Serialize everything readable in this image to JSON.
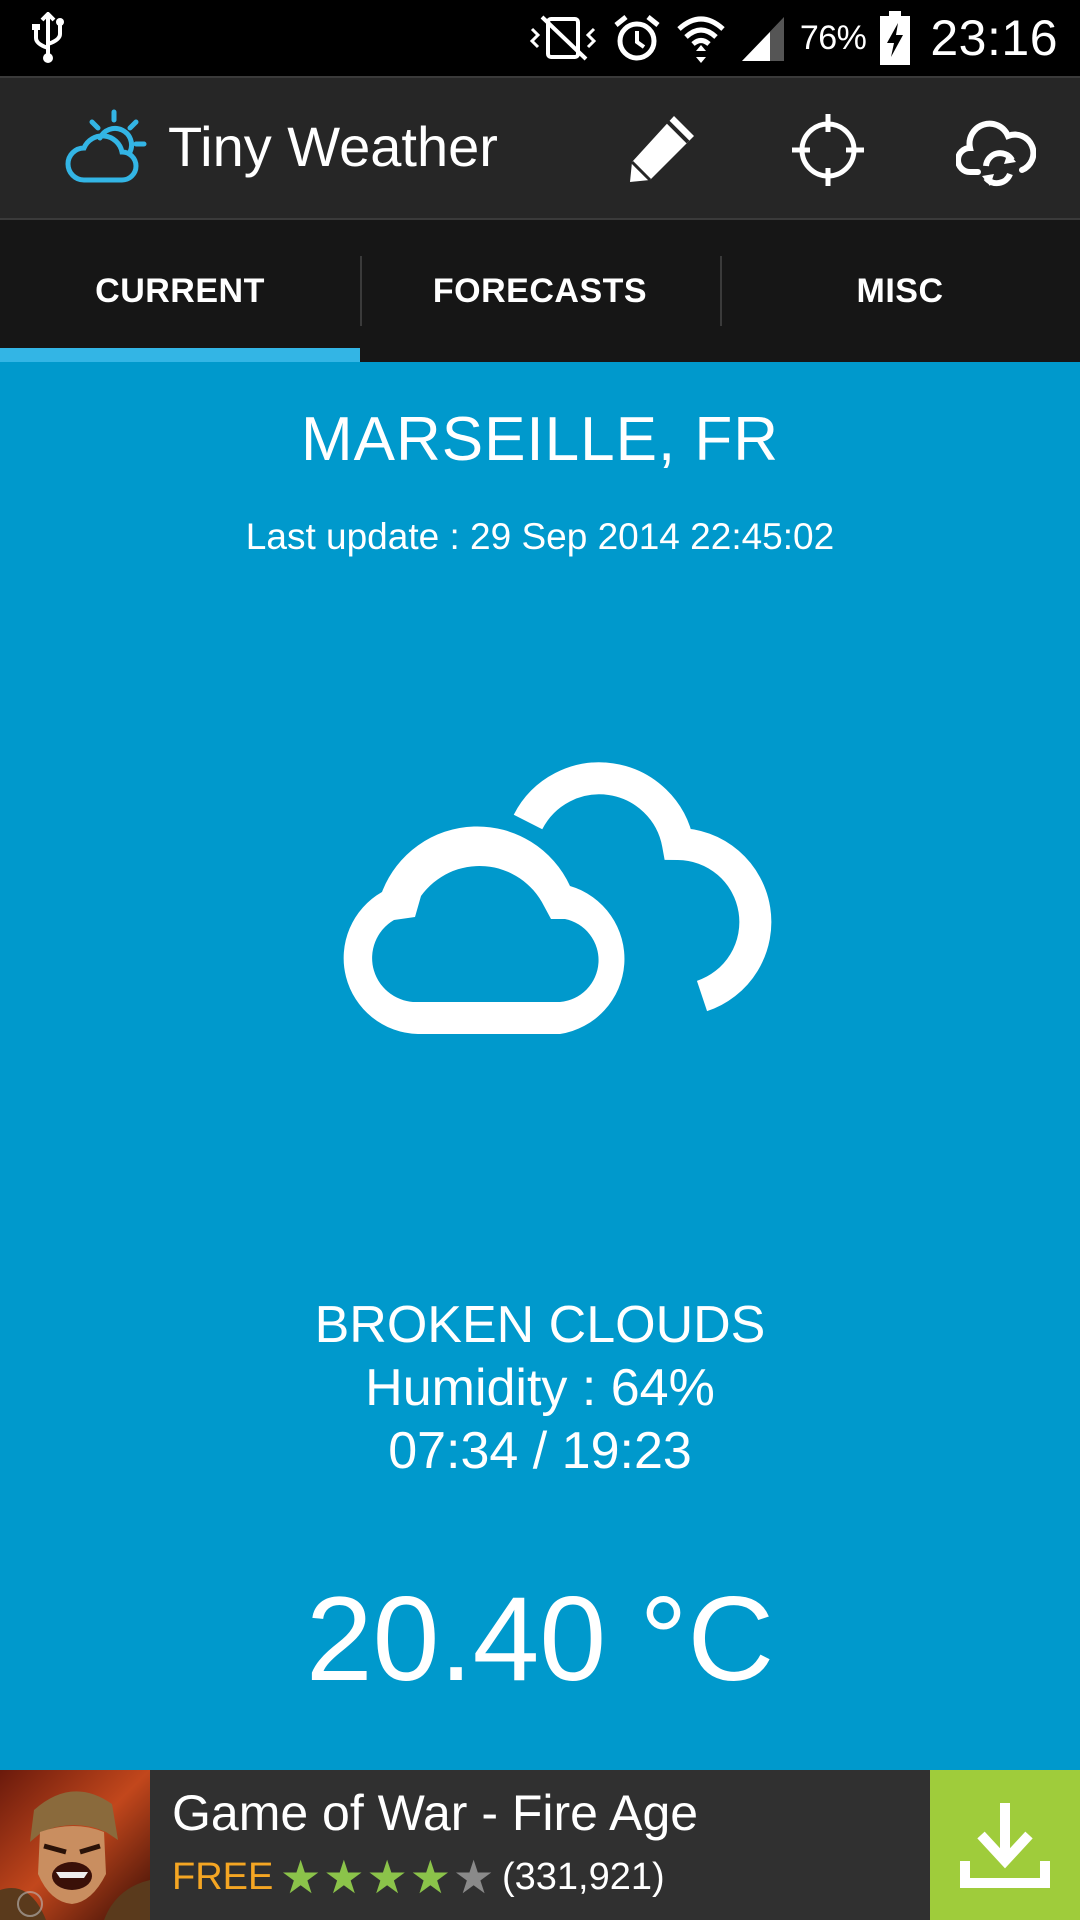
{
  "status_bar": {
    "battery_percent": "76%",
    "time": "23:16",
    "icons": [
      "usb-icon",
      "vibrate-mute-icon",
      "alarm-icon",
      "wifi-icon",
      "signal-icon",
      "battery-charging-icon"
    ]
  },
  "app_bar": {
    "title": "Tiny Weather",
    "logo_icon": "partly-cloudy-sun-icon",
    "actions": [
      {
        "name": "edit",
        "icon": "pencil-icon"
      },
      {
        "name": "locate",
        "icon": "crosshair-icon"
      },
      {
        "name": "refresh",
        "icon": "cloud-refresh-icon"
      }
    ]
  },
  "tabs": [
    {
      "label": "CURRENT",
      "selected": true
    },
    {
      "label": "FORECASTS",
      "selected": false
    },
    {
      "label": "MISC",
      "selected": false
    }
  ],
  "current": {
    "city": "MARSEILLE, FR",
    "last_update": "Last update : 29 Sep 2014 22:45:02",
    "condition_icon": "broken-clouds-icon",
    "condition": "BROKEN CLOUDS",
    "humidity": "Humidity : 64%",
    "sun_times": "07:34 / 19:23",
    "temperature": "20.40 °C"
  },
  "ad": {
    "title": "Game of War - Fire Age",
    "price": "FREE",
    "rating": 4,
    "rating_max": 5,
    "review_count": "(331,921)",
    "action_icon": "download-icon"
  },
  "colors": {
    "content_background": "#0099cc",
    "tab_indicator": "#33b5e5",
    "action_bar": "#262626",
    "tabs_background": "#161616",
    "ad_download": "#9fcc3b",
    "ad_free": "#f5a623",
    "star_on": "#8bc34a"
  }
}
